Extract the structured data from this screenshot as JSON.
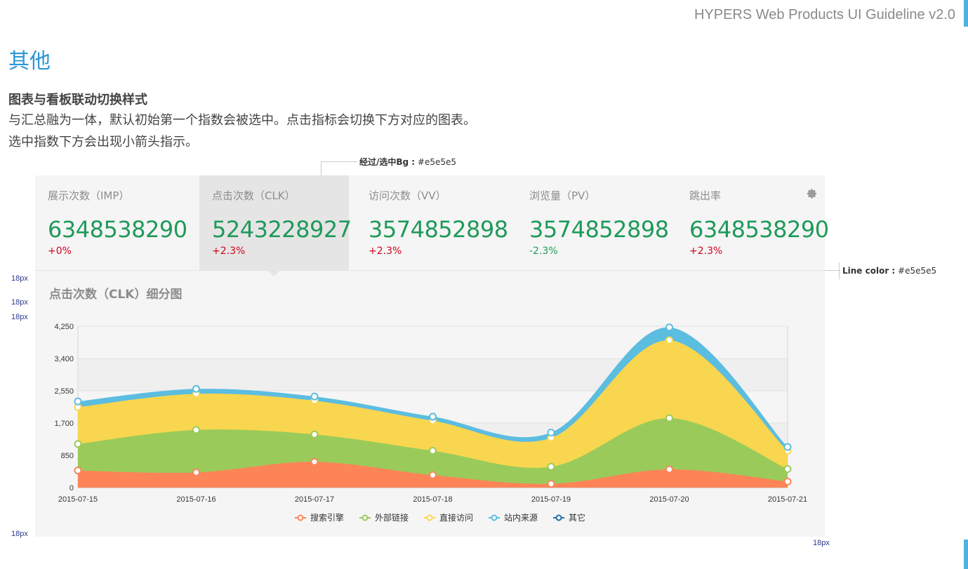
{
  "header": {
    "guideline_title": "HYPERS Web Products UI Guideline v2.0"
  },
  "page": {
    "section_title": "其他",
    "sub_title": "图表与看板联动切换样式",
    "desc_line1": "与汇总融为一体，默认初始第一个指数会被选中。点击指标会切换下方对应的图表。",
    "desc_line2": "选中指数下方会出现小箭头指示。"
  },
  "annotations": {
    "hover_bg_label": "经过/选中Bg :",
    "hover_bg_value": " #e5e5e5",
    "line_color_label": "Line color :",
    "line_color_value": " #e5e5e5",
    "spacing": "18px"
  },
  "kpis": [
    {
      "label": "展示次数（IMP）",
      "value": "6348538290",
      "change": "+0%",
      "dir": "up"
    },
    {
      "label": "点击次数（CLK）",
      "value": "5243228927",
      "change": "+2.3%",
      "dir": "up"
    },
    {
      "label": "访问次数（VV）",
      "value": "3574852898",
      "change": "+2.3%",
      "dir": "up"
    },
    {
      "label": "浏览量（PV）",
      "value": "3574852898",
      "change": "-2.3%",
      "dir": "down"
    },
    {
      "label": "跳出率",
      "value": "6348538290",
      "change": "+2.3%",
      "dir": "up"
    }
  ],
  "selected_kpi": 1,
  "icons": {
    "settings": "gear-icon"
  },
  "colors": {
    "selected_bg": "#e5e5e5",
    "line": "#e5e5e5",
    "value_green": "#1f9a5a",
    "up_red": "#d0021b"
  },
  "chart_title": "点击次数（CLK）细分图",
  "chart_data": {
    "type": "area",
    "stacked": true,
    "title": "点击次数（CLK）细分图",
    "categories": [
      "2015-07-15",
      "2015-07-16",
      "2015-07-17",
      "2015-07-18",
      "2015-07-19",
      "2015-07-20",
      "2015-07-21"
    ],
    "ylim": [
      0,
      4250
    ],
    "yticks": [
      0,
      850,
      1700,
      2550,
      3400,
      4250
    ],
    "ytick_labels": [
      "0",
      "850",
      "1,700",
      "2,550",
      "3,400",
      "4,250"
    ],
    "legend_position": "bottom",
    "series": [
      {
        "name": "搜索引擎",
        "color": "#fd8457",
        "values": [
          450,
          400,
          680,
          330,
          100,
          480,
          160
        ]
      },
      {
        "name": "外部链接",
        "color": "#9acb5a",
        "values": [
          700,
          1120,
          720,
          640,
          450,
          1350,
          330
        ]
      },
      {
        "name": "直接访问",
        "color": "#f9d64f",
        "values": [
          970,
          950,
          890,
          790,
          760,
          2050,
          480
        ]
      },
      {
        "name": "站内来源",
        "color": "#5bbde0",
        "values": [
          150,
          130,
          110,
          110,
          140,
          340,
          100
        ]
      },
      {
        "name": "其它",
        "color": "#1f6fa3",
        "values": [
          0,
          0,
          0,
          0,
          0,
          0,
          0
        ]
      }
    ]
  }
}
